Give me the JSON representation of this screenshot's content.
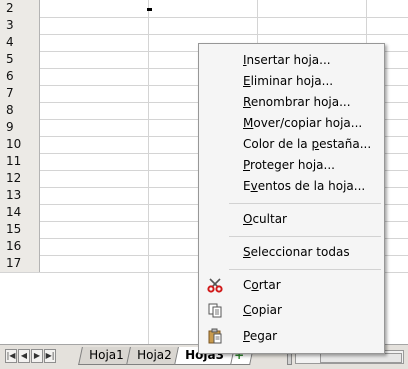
{
  "rows": [
    "2",
    "3",
    "4",
    "5",
    "6",
    "7",
    "8",
    "9",
    "10",
    "11",
    "12",
    "13",
    "14",
    "15",
    "16",
    "17"
  ],
  "context_menu": {
    "items": [
      {
        "pre": "",
        "key": "I",
        "post": "nsertar hoja..."
      },
      {
        "pre": "",
        "key": "E",
        "post": "liminar hoja..."
      },
      {
        "pre": "",
        "key": "R",
        "post": "enombrar hoja..."
      },
      {
        "pre": "",
        "key": "M",
        "post": "over/copiar hoja..."
      },
      {
        "pre": "Color de la ",
        "key": "p",
        "post": "estaña..."
      },
      {
        "pre": "",
        "key": "P",
        "post": "roteger hoja..."
      },
      {
        "pre": "E",
        "key": "v",
        "post": "entos de la hoja..."
      },
      {
        "pre": "",
        "key": "O",
        "post": "cultar"
      },
      {
        "pre": "",
        "key": "S",
        "post": "eleccionar todas"
      },
      {
        "pre": "C",
        "key": "o",
        "post": "rtar",
        "icon": "scissors-icon"
      },
      {
        "pre": "",
        "key": "C",
        "post": "opiar",
        "icon": "copy-icon"
      },
      {
        "pre": "",
        "key": "P",
        "post": "egar",
        "icon": "paste-icon"
      }
    ]
  },
  "sheet_tabs": {
    "tabs": [
      "Hoja1",
      "Hoja2",
      "Hoja3"
    ],
    "active": "Hoja3",
    "add_symbol": "+"
  },
  "nav": {
    "first": "|◀",
    "prev": "◀",
    "next": "▶",
    "last": "▶|"
  }
}
